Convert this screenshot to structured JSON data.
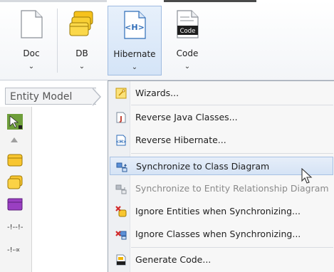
{
  "toolbar": {
    "buttons": [
      {
        "label": "Doc",
        "chevron": "⌄"
      },
      {
        "label": "DB",
        "chevron": "⌄"
      },
      {
        "label": "Hibernate",
        "chevron": "⌄"
      },
      {
        "label": "Code",
        "chevron": "⌄"
      }
    ],
    "hibernate_icon_text": "<H>",
    "code_icon_text": "Code"
  },
  "diagram_tab": {
    "label": "Entity Model"
  },
  "palette": {
    "tools": [
      "pointer-tool-icon",
      "collapse-arrow-icon",
      "entity-icon",
      "entity-stack-icon",
      "view-icon",
      "relationship-icon",
      "one-to-many-icon"
    ],
    "relationship_glyph": "-!--!-",
    "one_to_many_glyph": "-!-∝"
  },
  "menu": {
    "items": [
      {
        "label": "Wizards...",
        "icon": "wizard-icon",
        "disabled": false
      },
      {
        "label": "Reverse Java Classes...",
        "icon": "java-icon",
        "disabled": false
      },
      {
        "label": "Reverse Hibernate...",
        "icon": "hibernate-icon",
        "disabled": false
      },
      {
        "label": "Synchronize to Class Diagram",
        "icon": "sync-class-icon",
        "disabled": false,
        "hover": true
      },
      {
        "label": "Synchronize to Entity Relationship Diagram",
        "icon": "sync-erd-icon",
        "disabled": true
      },
      {
        "label": "Ignore Entities when Synchronizing...",
        "icon": "ignore-entities-icon",
        "disabled": false
      },
      {
        "label": "Ignore Classes when Synchronizing...",
        "icon": "ignore-classes-icon",
        "disabled": false
      },
      {
        "label": "Generate Code...",
        "icon": "generate-code-icon",
        "disabled": false
      }
    ]
  },
  "colors": {
    "accent": "#3d7bd1",
    "hover_bg": "#d5e3f5",
    "menu_bg": "#f7f7f7"
  }
}
